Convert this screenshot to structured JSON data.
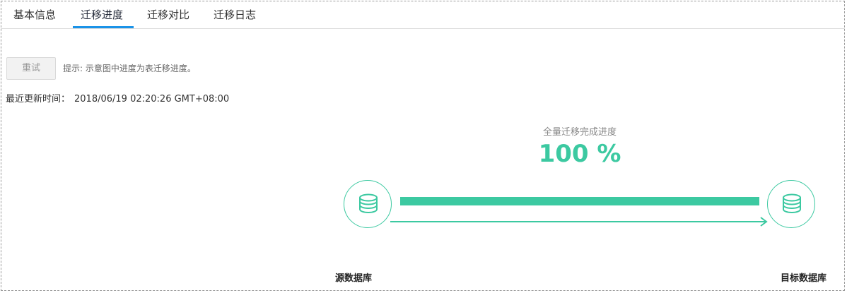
{
  "tabs": [
    {
      "label": "基本信息"
    },
    {
      "label": "迁移进度",
      "active": true
    },
    {
      "label": "迁移对比"
    },
    {
      "label": "迁移日志"
    }
  ],
  "toolbar": {
    "retry_label": "重试",
    "hint": "提示: 示意图中进度为表迁移进度。"
  },
  "update": {
    "label": "最近更新时间：",
    "value": "2018/06/19 02:20:26 GMT+08:00"
  },
  "progress": {
    "title": "全量迁移完成进度",
    "value_text": "100 %",
    "fraction": 1.0
  },
  "source": {
    "label": "源数据库",
    "icon": "database-icon"
  },
  "target": {
    "label": "目标数据库",
    "icon": "database-icon"
  },
  "colors": {
    "accent": "#3cc9a1",
    "tab_underline": "#1a93e8"
  }
}
